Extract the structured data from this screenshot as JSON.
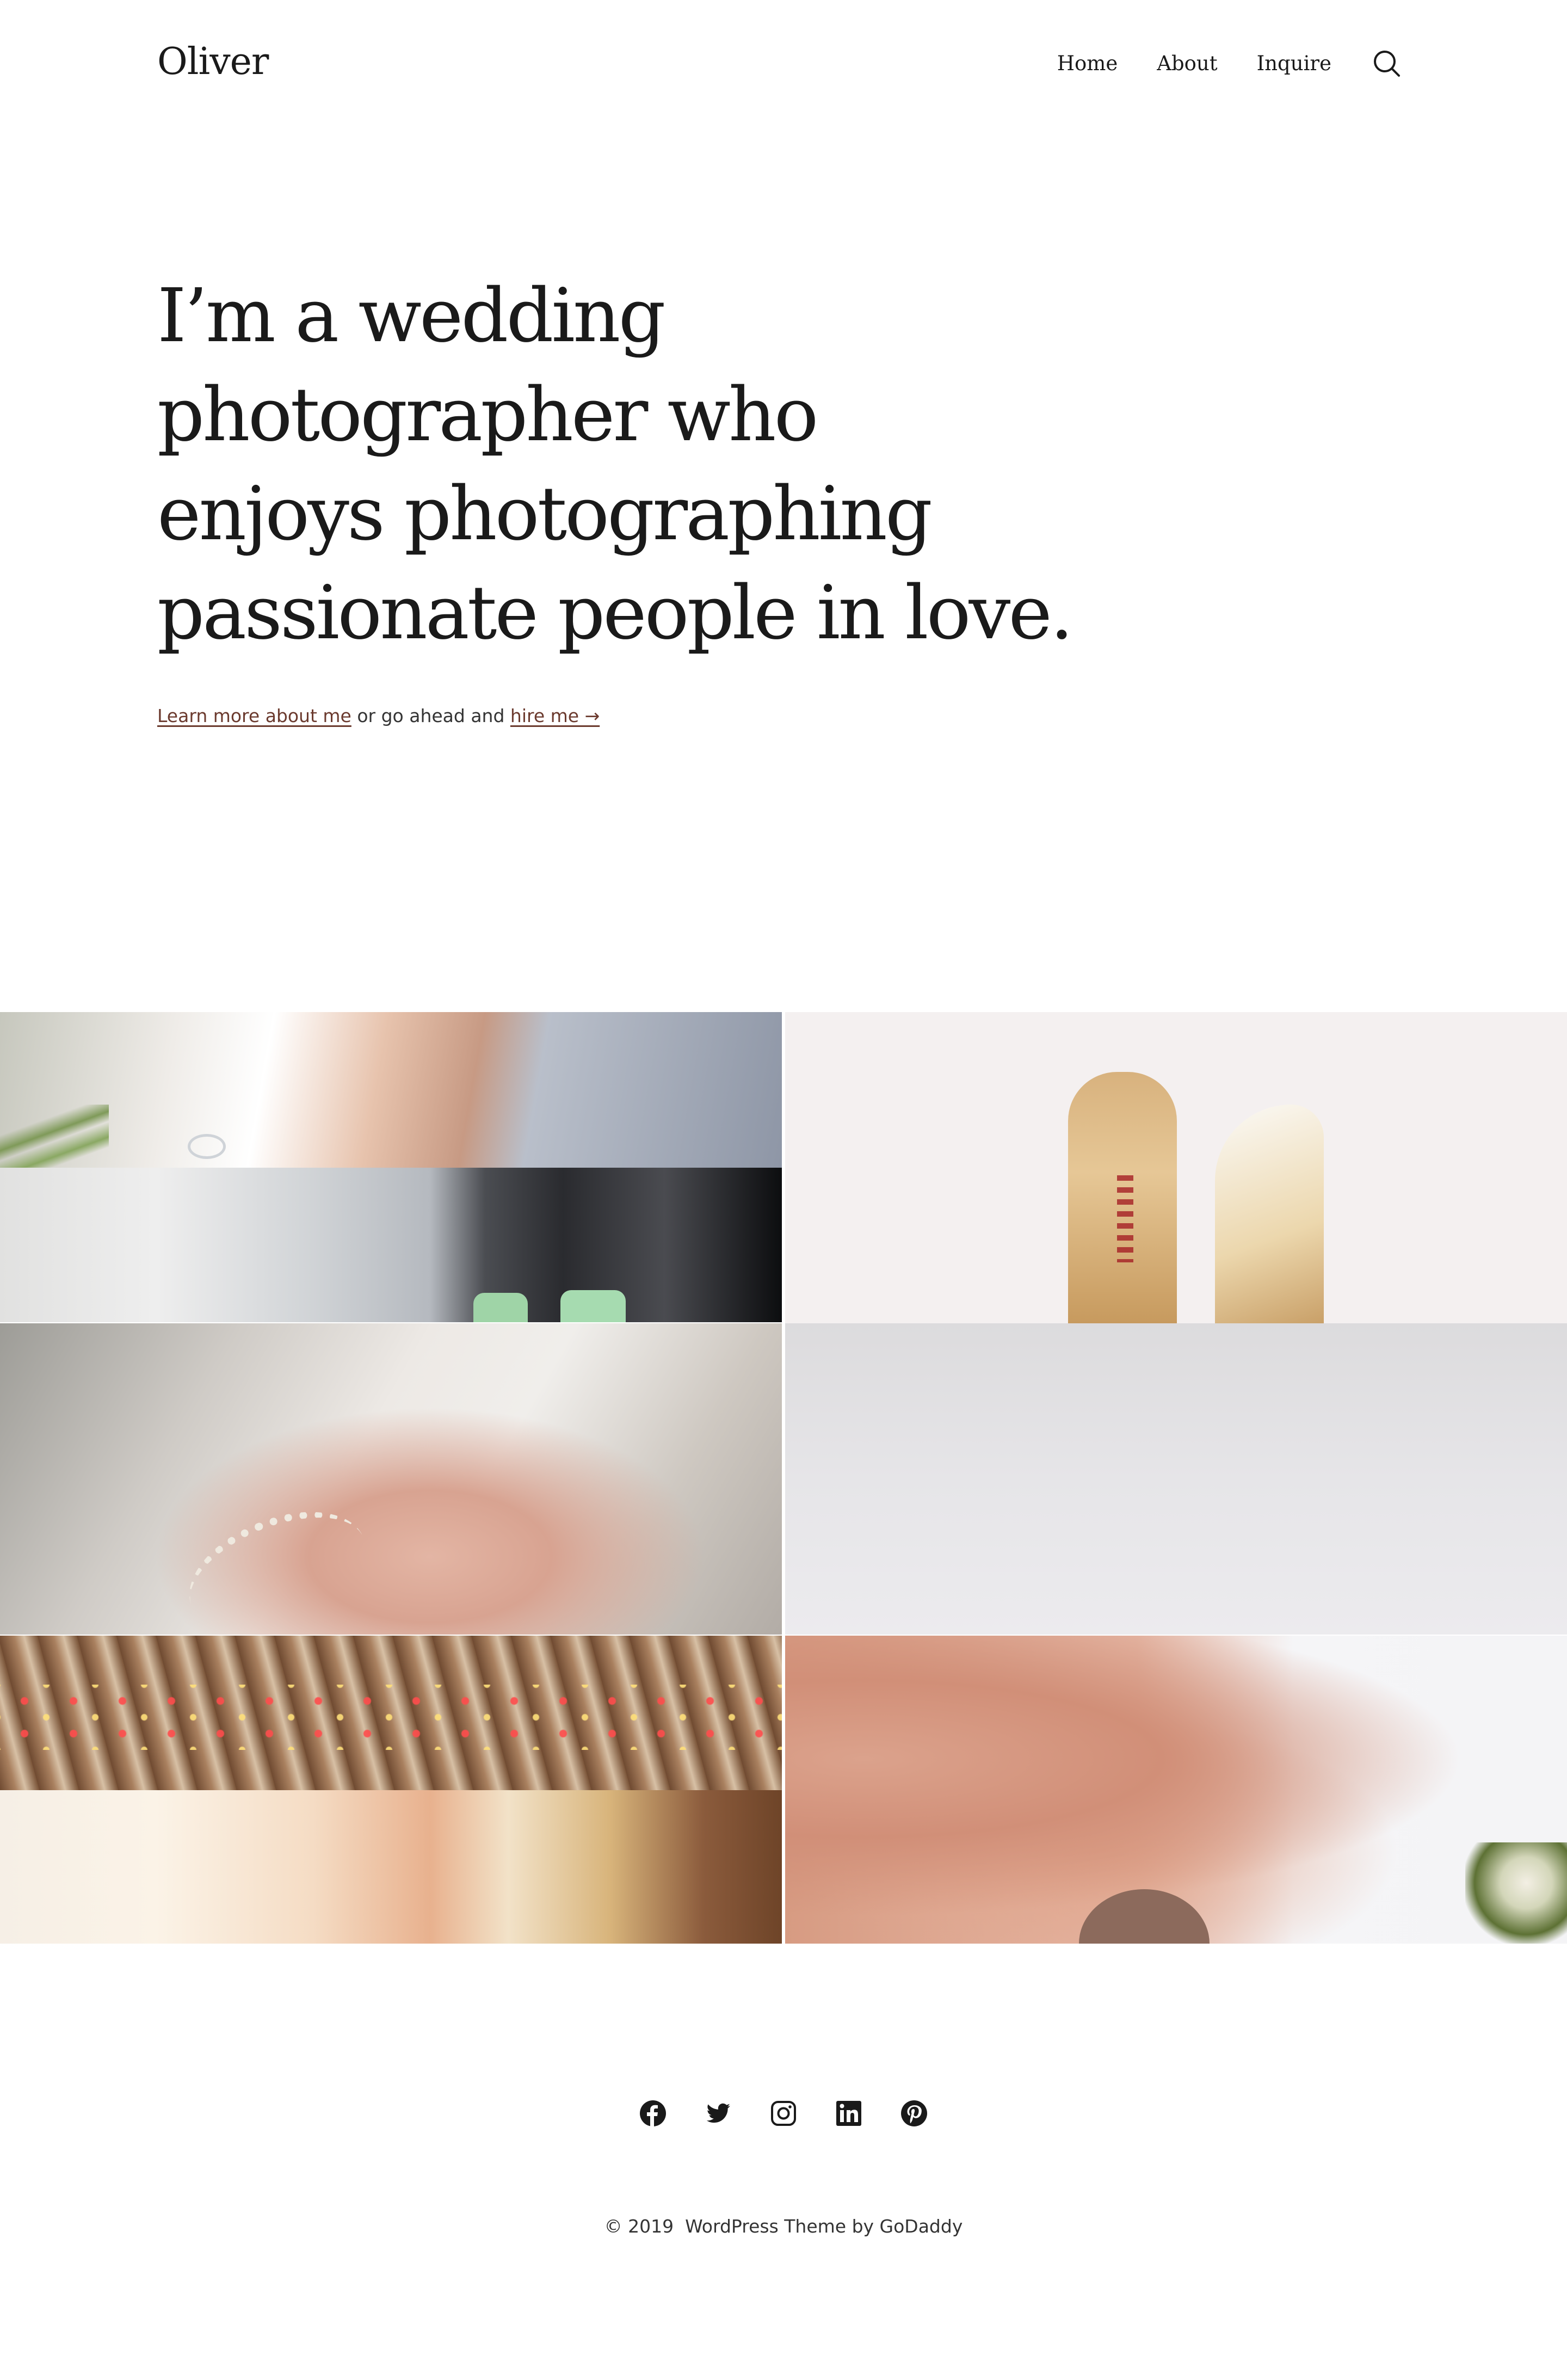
{
  "header": {
    "site_title": "Oliver",
    "nav": [
      {
        "label": "Home"
      },
      {
        "label": "About"
      },
      {
        "label": "Inquire"
      }
    ],
    "search_icon": "search-icon"
  },
  "hero": {
    "heading_lines": [
      "I’m a wedding",
      "photographer who",
      "enjoys photographing",
      "passionate people in love."
    ],
    "link_about": "Learn more about me",
    "text_middle": " or go ahead and ",
    "link_hire": "hire me →",
    "link_color": "#6b3a2e"
  },
  "gallery": {
    "photos": [
      {
        "subject": "bride hand with ring"
      },
      {
        "subject": "veil and grooms' green socks"
      },
      {
        "subject": "holding hands with bracelet"
      },
      {
        "subject": "wooden ceiling with string lights"
      },
      {
        "subject": "ceremony with henna hands"
      },
      {
        "subject": "gold Rainbow shoes"
      },
      {
        "subject": "light grey backdrop"
      },
      {
        "subject": "bride with bouquet under autumn trees"
      }
    ]
  },
  "footer": {
    "social_icons": [
      "facebook-icon",
      "twitter-icon",
      "instagram-icon",
      "linkedin-icon",
      "pinterest-icon"
    ],
    "copyright": "© 2019  WordPress Theme by GoDaddy"
  }
}
